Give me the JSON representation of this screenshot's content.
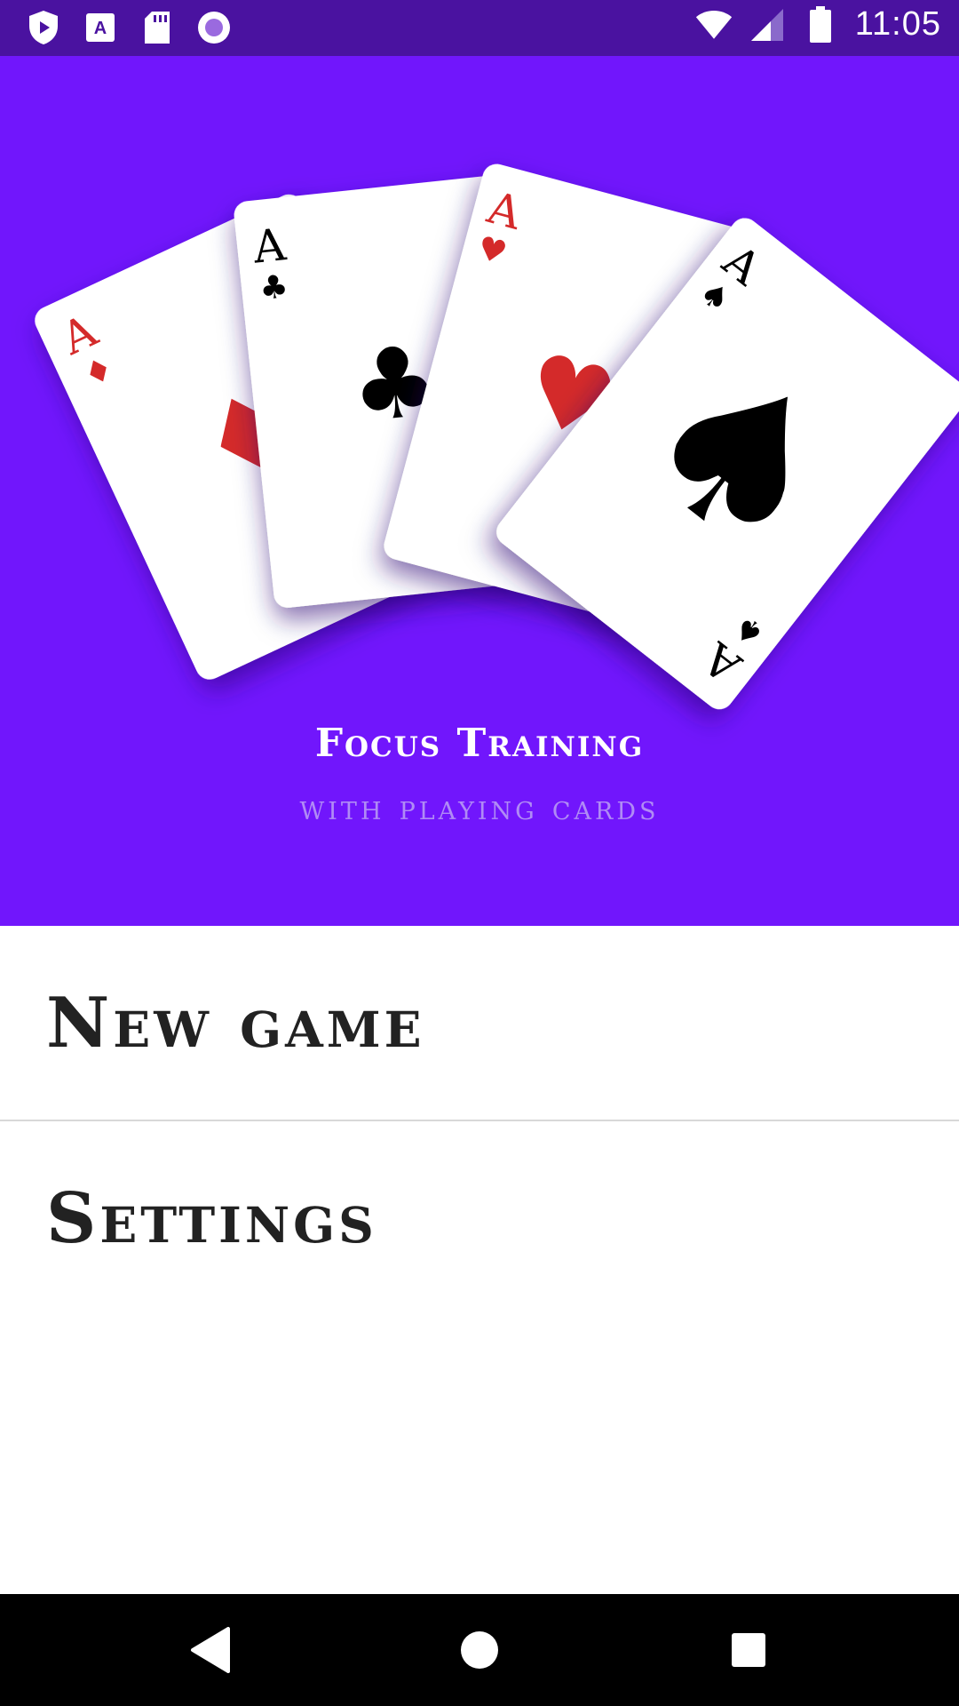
{
  "status_bar": {
    "time": "11:05",
    "left_icons": [
      "play-protect-icon",
      "text-a-icon",
      "sd-card-icon",
      "record-icon"
    ],
    "right_icons": [
      "wifi-icon",
      "signal-icon",
      "battery-icon"
    ]
  },
  "hero": {
    "background": "#7116fc",
    "title": "Focus Training",
    "subtitle": "with playing cards",
    "cards": [
      {
        "rank": "A",
        "suit": "♦",
        "color": "#d42a2a"
      },
      {
        "rank": "A",
        "suit": "♣",
        "color": "#000000"
      },
      {
        "rank": "A",
        "suit": "♥",
        "color": "#d42a2a"
      },
      {
        "rank": "A",
        "suit": "♠",
        "color": "#000000"
      }
    ]
  },
  "menu": {
    "items": [
      {
        "label": "New game"
      },
      {
        "label": "Settings"
      }
    ]
  },
  "nav_bar": {
    "buttons": [
      "back-icon",
      "home-icon",
      "recents-icon"
    ]
  }
}
